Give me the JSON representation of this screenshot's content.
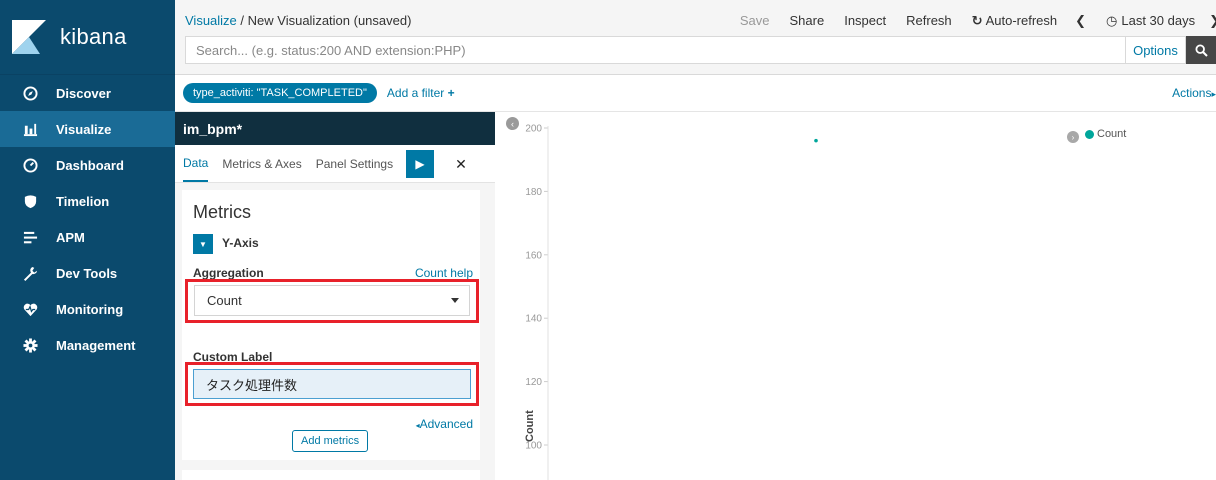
{
  "sidebar": {
    "logo_text": "kibana",
    "items": [
      {
        "label": "Discover",
        "icon": "compass-icon"
      },
      {
        "label": "Visualize",
        "icon": "bar-chart-icon"
      },
      {
        "label": "Dashboard",
        "icon": "dashboard-icon"
      },
      {
        "label": "Timelion",
        "icon": "shield-icon"
      },
      {
        "label": "APM",
        "icon": "apm-icon"
      },
      {
        "label": "Dev Tools",
        "icon": "wrench-icon"
      },
      {
        "label": "Monitoring",
        "icon": "heartbeat-icon"
      },
      {
        "label": "Management",
        "icon": "gear-icon"
      }
    ],
    "active_index": 1,
    "colors": {
      "bg": "#0b4a6d",
      "active": "#1a6b96"
    }
  },
  "header": {
    "breadcrumb_link": "Visualize",
    "breadcrumb_sep": " / ",
    "breadcrumb_current": "New Visualization (unsaved)",
    "save_label": "Save",
    "share_label": "Share",
    "inspect_label": "Inspect",
    "refresh_label": "Refresh",
    "auto_refresh_label": "Auto-refresh",
    "time_range_label": "Last 30 days"
  },
  "search": {
    "placeholder": "Search... (e.g. status:200 AND extension:PHP)",
    "options_label": "Options"
  },
  "filters": {
    "pill_label": "type_activiti: \"TASK_COMPLETED\"",
    "add_filter_label": "Add a filter",
    "actions_label": "Actions"
  },
  "editor": {
    "vis_title": "im_bpm*",
    "tabs": [
      "Data",
      "Metrics & Axes",
      "Panel Settings"
    ],
    "active_tab": 0,
    "metrics_heading": "Metrics",
    "yaxis_label": "Y-Axis",
    "aggregation_label": "Aggregation",
    "count_help_label": "Count help",
    "aggregation_value": "Count",
    "custom_label_title": "Custom Label",
    "custom_label_value": "タスク処理件数",
    "advanced_label": "Advanced",
    "add_metrics_label": "Add metrics",
    "highlight_color": "#e8212a"
  },
  "chart_data": {
    "type": "scatter",
    "title": "",
    "ylabel": "Count",
    "xlabel": "",
    "yticks": [
      200,
      180,
      160,
      140,
      120,
      100
    ],
    "ylim": [
      100,
      200
    ],
    "series": [
      {
        "name": "Count",
        "color": "#00a69b",
        "points": [
          {
            "y": 196
          }
        ]
      }
    ],
    "legend": "top-right"
  }
}
